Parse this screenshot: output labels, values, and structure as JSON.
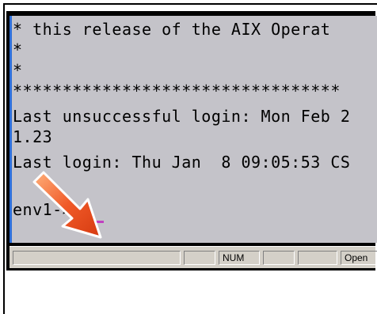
{
  "terminal": {
    "lines": [
      "* this release of the AIX Operat",
      "*",
      "*",
      "*********************************",
      "Last unsuccessful login: Mon Feb 2",
      "1.23",
      "Last login: Thu Jan  8 09:05:53 CS",
      "",
      "env1->"
    ]
  },
  "statusbar": {
    "panes": [
      "",
      "",
      "NUM",
      "",
      "",
      "Open"
    ]
  },
  "icons": {
    "pointer": "pointer-arrow-icon"
  },
  "colors": {
    "terminal_bg": "#c4c3c9",
    "accent_border": "#2f6fd8",
    "cursor": "#c040c0",
    "arrow": "#f05a28"
  }
}
